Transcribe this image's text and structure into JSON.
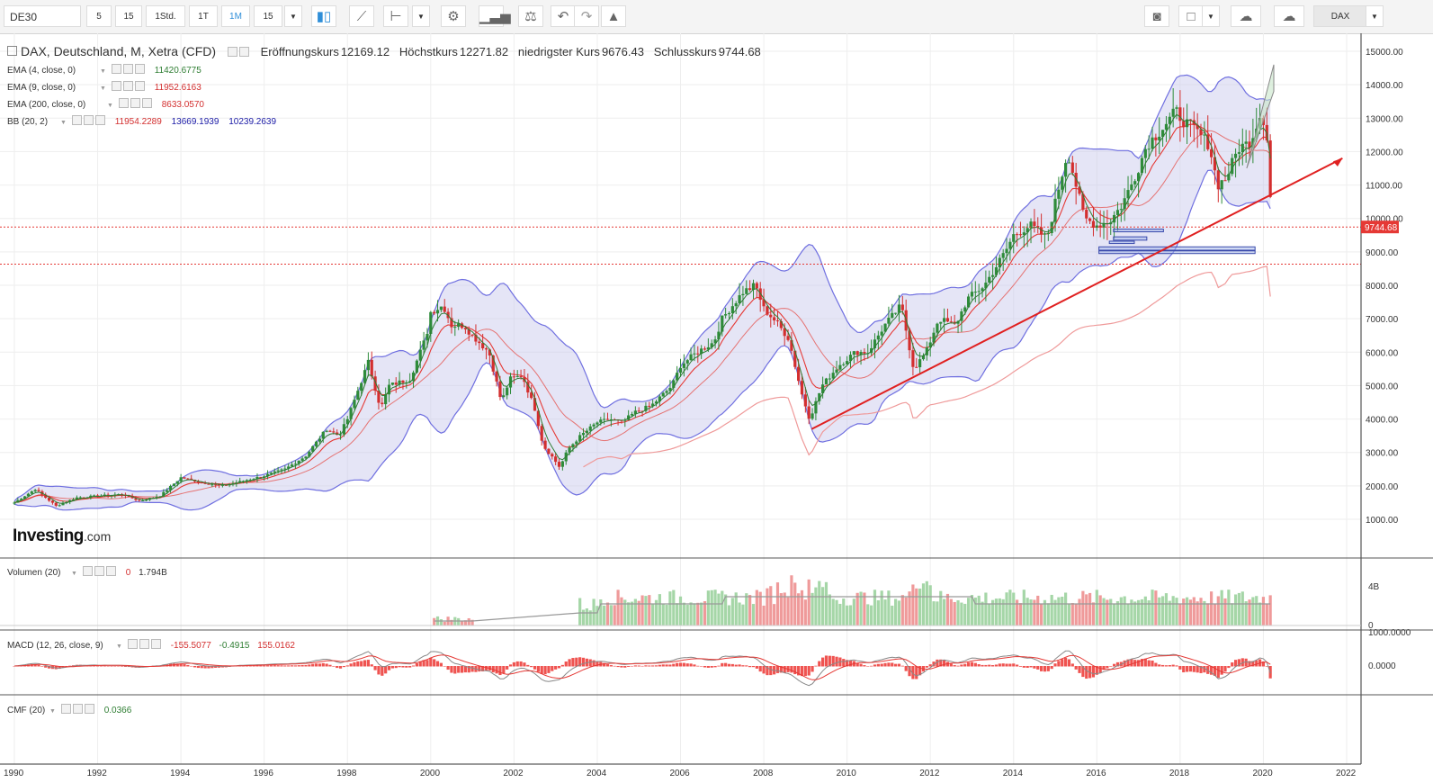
{
  "toolbar": {
    "symbol": "DE30",
    "intervals": [
      "5",
      "15",
      "1Std.",
      "1T",
      "1M",
      "15"
    ],
    "active_interval": "1M",
    "symbol_right": "DAX",
    "icons": [
      "candlestick-icon",
      "line-chart-icon",
      "indicator-icon",
      "settings-icon",
      "study-icon",
      "compare-icon",
      "undo-icon",
      "redo-icon",
      "alert-icon",
      "camera-icon",
      "color-box-icon",
      "cloud-download-icon",
      "cloud-upload-icon"
    ]
  },
  "header": {
    "instrument": "DAX, Deutschland, M, Xetra (CFD)",
    "ohlc": [
      {
        "label": "Eröffnungskurs",
        "value": "12169.12"
      },
      {
        "label": "Höchstkurs",
        "value": "12271.82"
      },
      {
        "label": "niedrigster Kurs",
        "value": "9676.43"
      },
      {
        "label": "Schlusskurs",
        "value": "9744.68"
      }
    ]
  },
  "indicators": [
    {
      "label": "EMA (4, close, 0)",
      "values": [
        "11420.6775"
      ],
      "colors": [
        "#2e7d32"
      ]
    },
    {
      "label": "EMA (9, close, 0)",
      "values": [
        "11952.6163"
      ],
      "colors": [
        "#d32f2f"
      ]
    },
    {
      "label": "EMA (200, close, 0)",
      "values": [
        "8633.0570"
      ],
      "colors": [
        "#d32f2f"
      ]
    },
    {
      "label": "BB (20, 2)",
      "values": [
        "11954.2289",
        "13669.1939",
        "10239.2639"
      ],
      "colors": [
        "#d32f2f",
        "#1a1aa6",
        "#1a1aa6"
      ]
    }
  ],
  "volume_pane": {
    "label": "Volumen (20)",
    "values": [
      "0",
      "1.794B"
    ],
    "axis_ticks": [
      "4B",
      "0"
    ]
  },
  "macd_pane": {
    "label": "MACD (12, 26, close, 9)",
    "values": [
      "-155.5077",
      "-0.4915",
      "155.0162"
    ],
    "axis_ticks": [
      "1000.0000",
      "0.0000"
    ]
  },
  "cmf_pane": {
    "label": "CMF (20)",
    "values": [
      "0.0366"
    ]
  },
  "watermark": {
    "brand": "Investing",
    "suffix": ".com"
  },
  "price_marker": "9744.68",
  "colors": {
    "up": "#2e8b3a",
    "down": "#d32f2f",
    "bb_fill": "#c5c5ec",
    "bb_line": "#6f6fe0",
    "trendline": "#e02020",
    "accent": "#2f8ed8"
  },
  "chart_data": {
    "type": "candlestick",
    "title": "DAX, Deutschland, M, Xetra (CFD)",
    "x_ticks": [
      "1990",
      "1992",
      "1994",
      "1996",
      "1998",
      "2000",
      "2002",
      "2004",
      "2006",
      "2008",
      "2010",
      "2012",
      "2014",
      "2016",
      "2018",
      "2020",
      "2022"
    ],
    "y_ticks": [
      "1000.00",
      "2000.00",
      "3000.00",
      "4000.00",
      "5000.00",
      "6000.00",
      "7000.00",
      "8000.00",
      "9000.00",
      "10000.00",
      "11000.00",
      "12000.00",
      "13000.00",
      "14000.00",
      "15000.00"
    ],
    "ylim": [
      0,
      15500
    ],
    "xlim": [
      1990,
      2022.3
    ],
    "close_path": [
      [
        1990,
        1500
      ],
      [
        1990.5,
        1900
      ],
      [
        1991,
        1400
      ],
      [
        1991.5,
        1650
      ],
      [
        1992,
        1700
      ],
      [
        1992.6,
        1750
      ],
      [
        1993,
        1550
      ],
      [
        1993.5,
        1700
      ],
      [
        1994,
        2250
      ],
      [
        1994.5,
        2100
      ],
      [
        1995,
        2000
      ],
      [
        1995.5,
        2150
      ],
      [
        1996,
        2300
      ],
      [
        1996.5,
        2500
      ],
      [
        1997,
        2900
      ],
      [
        1997.5,
        3700
      ],
      [
        1997.8,
        3500
      ],
      [
        1998,
        4000
      ],
      [
        1998.5,
        5700
      ],
      [
        1998.8,
        4300
      ],
      [
        1999,
        5000
      ],
      [
        1999.5,
        5200
      ],
      [
        1999.9,
        6500
      ],
      [
        2000,
        7200
      ],
      [
        2000.3,
        7400
      ],
      [
        2000.5,
        6800
      ],
      [
        2000.8,
        6800
      ],
      [
        2001,
        6500
      ],
      [
        2001.4,
        6000
      ],
      [
        2001.7,
        4500
      ],
      [
        2001.9,
        5200
      ],
      [
        2002.2,
        5300
      ],
      [
        2002.5,
        4300
      ],
      [
        2002.7,
        3200
      ],
      [
        2002.9,
        2900
      ],
      [
        2003.1,
        2550
      ],
      [
        2003.3,
        3100
      ],
      [
        2003.6,
        3500
      ],
      [
        2004,
        3900
      ],
      [
        2004.3,
        4000
      ],
      [
        2004.6,
        3900
      ],
      [
        2004.9,
        4200
      ],
      [
        2005.3,
        4400
      ],
      [
        2005.8,
        5000
      ],
      [
        2006,
        5600
      ],
      [
        2006.4,
        6000
      ],
      [
        2006.8,
        6300
      ],
      [
        2007,
        7000
      ],
      [
        2007.5,
        7800
      ],
      [
        2007.8,
        8000
      ],
      [
        2008,
        7300
      ],
      [
        2008.3,
        6900
      ],
      [
        2008.6,
        6400
      ],
      [
        2008.9,
        4800
      ],
      [
        2009.1,
        4000
      ],
      [
        2009.4,
        5000
      ],
      [
        2009.8,
        5600
      ],
      [
        2010.2,
        6000
      ],
      [
        2010.5,
        6000
      ],
      [
        2010.9,
        6800
      ],
      [
        2011.3,
        7400
      ],
      [
        2011.6,
        5500
      ],
      [
        2011.9,
        6000
      ],
      [
        2012.2,
        7000
      ],
      [
        2012.6,
        6800
      ],
      [
        2012.9,
        7600
      ],
      [
        2013.3,
        8000
      ],
      [
        2013.8,
        9000
      ],
      [
        2014,
        9500
      ],
      [
        2014.4,
        9800
      ],
      [
        2014.8,
        9400
      ],
      [
        2015.1,
        11000
      ],
      [
        2015.3,
        12000
      ],
      [
        2015.7,
        10000
      ],
      [
        2016,
        9800
      ],
      [
        2016.3,
        9900
      ],
      [
        2016.6,
        10400
      ],
      [
        2016.9,
        11200
      ],
      [
        2017.2,
        12200
      ],
      [
        2017.5,
        12600
      ],
      [
        2017.9,
        13200
      ],
      [
        2018.1,
        12900
      ],
      [
        2018.4,
        12600
      ],
      [
        2018.7,
        12200
      ],
      [
        2018.9,
        11000
      ],
      [
        2019.1,
        11200
      ],
      [
        2019.4,
        12100
      ],
      [
        2019.7,
        12300
      ],
      [
        2019.9,
        13100
      ],
      [
        2020.05,
        12900
      ],
      [
        2020.12,
        11900
      ],
      [
        2020.2,
        9745
      ]
    ],
    "last_close": 9744.68,
    "reference_lines": [
      9744.68,
      8633.06
    ],
    "trendline": {
      "from": [
        2009.15,
        3700
      ],
      "to": [
        2021.9,
        11800
      ]
    }
  }
}
